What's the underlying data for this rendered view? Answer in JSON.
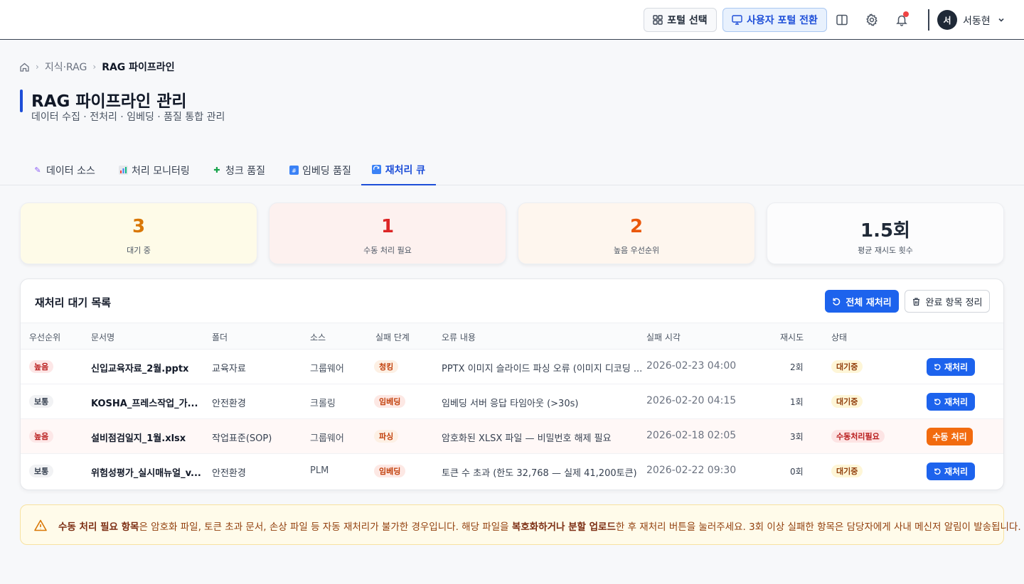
{
  "header": {
    "portal_select_label": "포털 선택",
    "portal_switch_label": "사용자 포털 전환",
    "user_initial": "서",
    "user_name": "서동현"
  },
  "breadcrumb": {
    "items": [
      "지식·RAG",
      "RAG 파이프라인"
    ]
  },
  "page": {
    "title": "RAG 파이프라인 관리",
    "subtitle": "데이터 수집 · 전처리 · 임베딩 · 품질 통합 관리"
  },
  "tabs": [
    {
      "label": "데이터 소스",
      "icon": "syringe-icon"
    },
    {
      "label": "처리 모니터링",
      "icon": "bar-chart-icon"
    },
    {
      "label": "청크 품질",
      "icon": "puzzle-icon"
    },
    {
      "label": "임베딩 품질",
      "icon": "numbers-icon"
    },
    {
      "label": "재처리 큐",
      "icon": "refresh-icon",
      "active": true
    }
  ],
  "stats": [
    {
      "value": "3",
      "label": "대기 중",
      "color": "#d97706",
      "bg": "#fefbe8"
    },
    {
      "value": "1",
      "label": "수동 처리 필요",
      "color": "#dc2626",
      "bg": "#fdf1ef"
    },
    {
      "value": "2",
      "label": "높음 우선순위",
      "color": "#ea580c",
      "bg": "#fef6ee"
    },
    {
      "value": "1.5회",
      "label": "평균 재시도 횟수",
      "color": "#1f2937",
      "bg": "#fcfcfd"
    }
  ],
  "queue": {
    "title": "재처리 대기 목록",
    "retry_all_label": "전체 재처리",
    "cleanup_label": "완료 항목 정리",
    "columns": [
      "우선순위",
      "문서명",
      "폴더",
      "소스",
      "실패 단계",
      "오류 내용",
      "실패 시각",
      "재시도",
      "상태"
    ],
    "rows": [
      {
        "priority": "높음",
        "doc": "신입교육자료_2월.pptx",
        "folder": "교육자료",
        "source": "그룹웨어",
        "stage": "청킹",
        "error": "PPTX 이미지 슬라이드 파싱 오류 (이미지 디코딩 ...",
        "time": "2026-02-23 04:00",
        "retries": "2회",
        "status": "대기중",
        "action": "재처리"
      },
      {
        "priority": "보통",
        "doc": "KOSHA_프레스작업_가...",
        "folder": "안전환경",
        "source": "크롤링",
        "stage": "임베딩",
        "error": "임베딩 서버 응답 타임아웃 (>30s)",
        "time": "2026-02-20 04:15",
        "retries": "1회",
        "status": "대기중",
        "action": "재처리"
      },
      {
        "priority": "높음",
        "doc": "설비점검일지_1월.xlsx",
        "folder": "작업표준(SOP)",
        "source": "그룹웨어",
        "stage": "파싱",
        "error": "암호화된 XLSX 파일 — 비밀번호 해제 필요",
        "time": "2026-02-18 02:05",
        "retries": "3회",
        "status": "수동처리필요",
        "action": "수동 처리"
      },
      {
        "priority": "보통",
        "doc": "위험성평가_실시매뉴얼_v...",
        "folder": "안전환경",
        "source": "PLM",
        "stage": "임베딩",
        "error": "토큰 수 초과 (한도 32,768 — 실제 41,200토큰)",
        "time": "2026-02-22 09:30",
        "retries": "0회",
        "status": "대기중",
        "action": "재처리"
      }
    ]
  },
  "notice": {
    "bold1": "수동 처리 필요 항목",
    "text1": "은 암호화 파일, 토큰 초과 문서, 손상 파일 등 자동 재처리가 불가한 경우입니다. 해당 파일을 ",
    "bold2": "복호화하거나 분할 업로드",
    "text2": "한 후 재처리 버튼을 눌러주세요. 3회 이상 실패한 항목은 담당자에게 사내 메신저 알림이 발송됩니다."
  }
}
